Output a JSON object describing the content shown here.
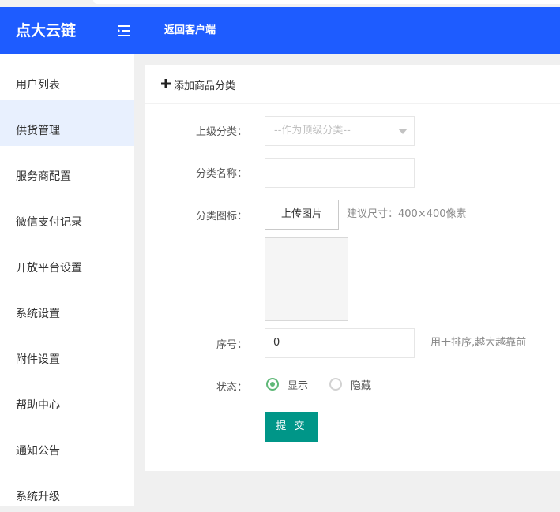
{
  "header": {
    "logo": "点大云链",
    "back_link": "返回客户端",
    "bg_color": "#1e5cff"
  },
  "sidebar": {
    "items": [
      {
        "label": "用户列表",
        "active": false
      },
      {
        "label": "供货管理",
        "active": true
      },
      {
        "label": "服务商配置",
        "active": false
      },
      {
        "label": "微信支付记录",
        "active": false
      },
      {
        "label": "开放平台设置",
        "active": false
      },
      {
        "label": "系统设置",
        "active": false
      },
      {
        "label": "附件设置",
        "active": false
      },
      {
        "label": "帮助中心",
        "active": false
      },
      {
        "label": "通知公告",
        "active": false
      },
      {
        "label": "系统升级",
        "active": false
      }
    ]
  },
  "form": {
    "title": "添加商品分类",
    "parent_label": "上级分类：",
    "parent_placeholder": "--作为顶级分类--",
    "name_label": "分类名称：",
    "name_value": "",
    "icon_label": "分类图标：",
    "upload_label": "上传图片",
    "upload_hint": "建议尺寸：400×400像素",
    "sort_label": "序号：",
    "sort_value": "0",
    "sort_hint": "用于排序,越大越靠前",
    "status_label": "状态：",
    "status_options": [
      {
        "label": "显示",
        "checked": true
      },
      {
        "label": "隐藏",
        "checked": false
      }
    ],
    "submit_label": "提 交",
    "submit_color": "#009688",
    "radio_color": "#5fb878"
  }
}
